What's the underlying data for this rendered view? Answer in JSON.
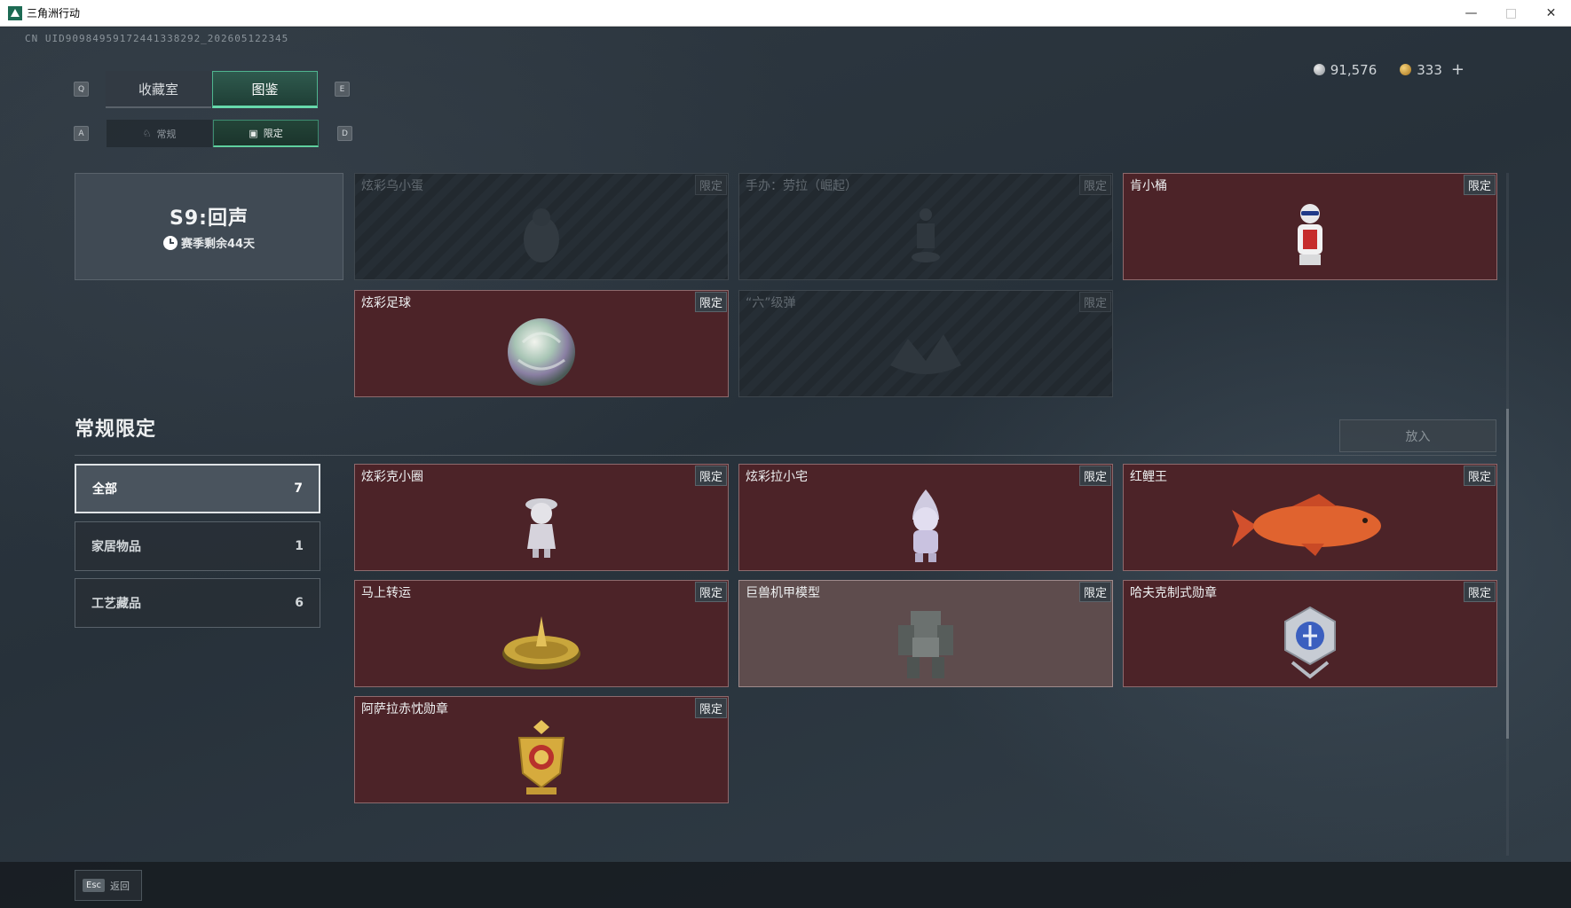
{
  "window": {
    "title": "三角洲行动",
    "minimize_icon": "minimize-icon",
    "maximize_icon": "maximize-icon",
    "close_icon": "close-icon"
  },
  "uid_text": "CN UID909849591724413382​92_202605122345",
  "currency": {
    "silver": "91,576",
    "gold": "333",
    "plus": "+"
  },
  "keys": {
    "q": "Q",
    "e": "E",
    "a": "A",
    "d": "D"
  },
  "tabs": [
    {
      "label": "收藏室"
    },
    {
      "label": "图鉴"
    }
  ],
  "subtabs": [
    {
      "label": "常规",
      "icon": "statue-icon"
    },
    {
      "label": "限定",
      "icon": "frame-icon"
    }
  ],
  "season": {
    "name": "S9:回声",
    "remaining": "赛季剩余44天"
  },
  "top_cards": [
    {
      "name": "炫彩乌小蛋",
      "badge": "限定",
      "locked": true,
      "icon": "egg-figure-icon"
    },
    {
      "name": "手办：劳拉（崛起）",
      "badge": "限定",
      "locked": true,
      "icon": "figure-icon"
    },
    {
      "name": "肯小桶",
      "badge": "限定",
      "locked": false,
      "icon": "colonel-figure-icon"
    },
    {
      "name": "炫彩足球",
      "badge": "限定",
      "locked": false,
      "icon": "soccer-ball-icon"
    },
    {
      "name": "“六”级弹",
      "badge": "限定",
      "locked": true,
      "icon": "bullet-icon"
    }
  ],
  "section": {
    "title": "常规限定",
    "put_label": "放入"
  },
  "filters": [
    {
      "label": "全部",
      "count": "7"
    },
    {
      "label": "家居物品",
      "count": "1"
    },
    {
      "label": "工艺藏品",
      "count": "6"
    }
  ],
  "cards": [
    {
      "name": "炫彩克小圈",
      "badge": "限定",
      "icon": "girl-figure-icon"
    },
    {
      "name": "炫彩拉小宅",
      "badge": "限定",
      "icon": "hooded-figure-icon"
    },
    {
      "name": "红鲤王",
      "badge": "限定",
      "icon": "carp-fish-icon"
    },
    {
      "name": "马上转运",
      "badge": "限定",
      "icon": "spinning-top-icon"
    },
    {
      "name": "巨兽机甲模型",
      "badge": "限定",
      "icon": "mech-model-icon"
    },
    {
      "name": "哈夫克制式勋章",
      "badge": "限定",
      "icon": "medal-icon"
    },
    {
      "name": "阿萨拉赤忱勋章",
      "badge": "限定",
      "icon": "gold-medal-icon"
    }
  ],
  "footer": {
    "esc_key": "Esc",
    "esc_label": "返回"
  },
  "colors": {
    "accent": "#67d9ac",
    "card_bg": "#4c2328",
    "card_border": "#8e6a6d"
  }
}
